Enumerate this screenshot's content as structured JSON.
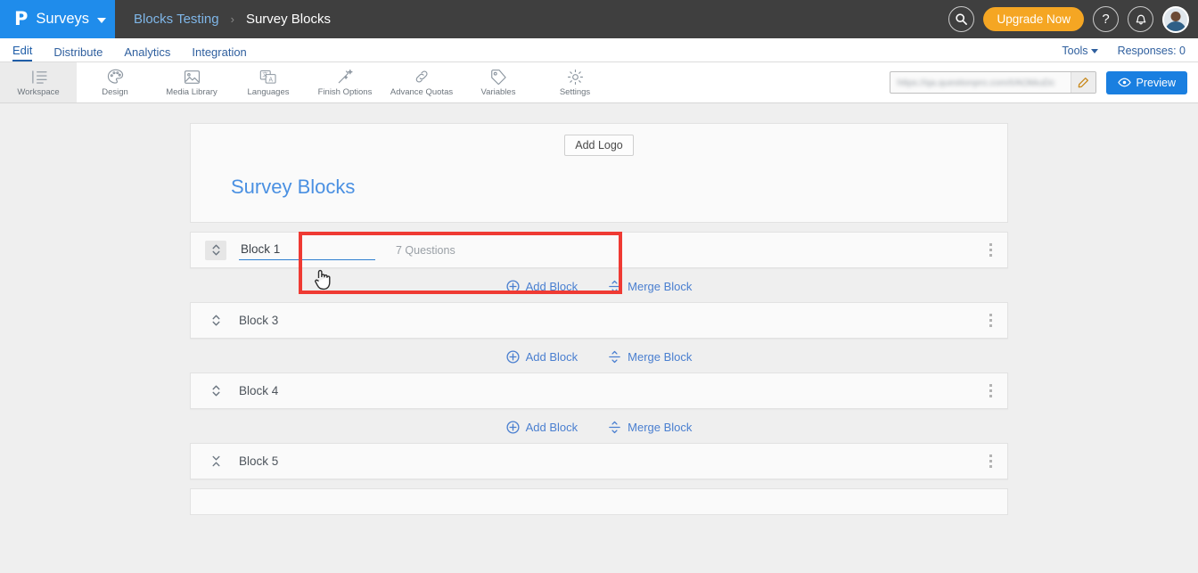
{
  "topbar": {
    "logo_letter": "P",
    "brand_label": "Surveys",
    "breadcrumb_parent": "Blocks Testing",
    "breadcrumb_sep": "›",
    "breadcrumb_current": "Survey Blocks",
    "search_icon": "search-icon",
    "upgrade_label": "Upgrade Now",
    "help_label": "?",
    "bell_icon": "bell-icon",
    "avatar_icon": "user-avatar"
  },
  "tabbar": {
    "tabs": [
      {
        "label": "Edit",
        "active": true
      },
      {
        "label": "Distribute",
        "active": false
      },
      {
        "label": "Analytics",
        "active": false
      },
      {
        "label": "Integration",
        "active": false
      }
    ],
    "tools_label": "Tools",
    "responses_label": "Responses: 0"
  },
  "toolstrip": {
    "items": [
      {
        "label": "Workspace",
        "icon": "workspace-icon",
        "active": true
      },
      {
        "label": "Design",
        "icon": "palette-icon",
        "active": false
      },
      {
        "label": "Media Library",
        "icon": "image-icon",
        "active": false
      },
      {
        "label": "Languages",
        "icon": "translate-icon",
        "active": false
      },
      {
        "label": "Finish Options",
        "icon": "magic-wand-icon",
        "active": false
      },
      {
        "label": "Advance Quotas",
        "icon": "chain-link-icon",
        "active": false
      },
      {
        "label": "Variables",
        "icon": "tag-icon",
        "active": false
      },
      {
        "label": "Settings",
        "icon": "gear-icon",
        "active": false
      }
    ],
    "survey_url": "https://qa.questionpro.com/t/AOkkuDc",
    "edit_icon": "pencil-icon",
    "preview_label": "Preview",
    "preview_icon": "eye-icon"
  },
  "canvas": {
    "add_logo_label": "Add Logo",
    "survey_title": "Survey Blocks",
    "blocks": [
      {
        "name": "Block 1",
        "question_count": "7 Questions",
        "editing": true,
        "sort_icon": "sort-updown-icon",
        "menu_icon": "kebab-menu-icon",
        "highlighted": true
      },
      {
        "name": "Block 3",
        "question_count": "",
        "editing": false,
        "sort_icon": "sort-updown-icon",
        "menu_icon": "kebab-menu-icon",
        "highlighted": false
      },
      {
        "name": "Block 4",
        "question_count": "",
        "editing": false,
        "sort_icon": "sort-updown-icon",
        "menu_icon": "kebab-menu-icon",
        "highlighted": false
      },
      {
        "name": "Block 5",
        "question_count": "",
        "editing": false,
        "sort_icon": "collapse-icon",
        "menu_icon": "kebab-menu-icon",
        "highlighted": false
      }
    ],
    "add_block_label": "Add Block",
    "add_block_icon": "circle-plus-icon",
    "merge_block_label": "Merge Block",
    "merge_block_icon": "merge-icon"
  },
  "colors": {
    "brand_blue": "#1f8ceb",
    "topbar_dark": "#3f3f3f",
    "accent_orange": "#f5a623",
    "link_blue": "#4a7fd0",
    "annotation_red": "#ef3a33",
    "title_blue": "#4a90e2"
  }
}
